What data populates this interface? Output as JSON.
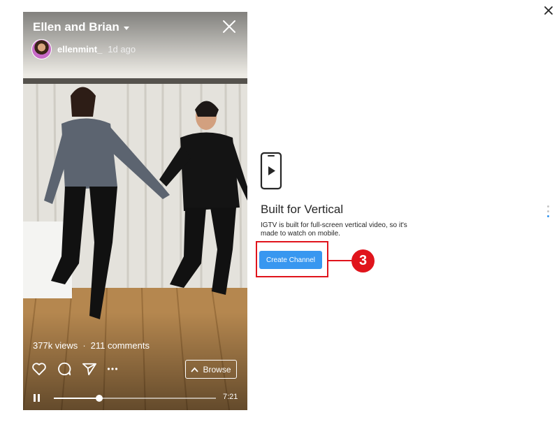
{
  "video": {
    "title": "Ellen and Brian",
    "username": "ellenmint_",
    "timestamp": "1d ago",
    "views": "377k views",
    "separator": "·",
    "comments": "211 comments",
    "browse_label": "Browse",
    "duration": "7:21",
    "progress": 0.28
  },
  "panel": {
    "title": "Built for Vertical",
    "description": "IGTV is built for full-screen vertical video, so it's made to watch on mobile.",
    "create_button": "Create Channel",
    "step_number": "3",
    "highlight_color": "#e0141c",
    "accent_color": "#3897f0"
  },
  "icons": {
    "page_close": "close-icon",
    "card_close": "close-icon",
    "like": "heart-icon",
    "comment": "comment-icon",
    "share": "send-icon",
    "more": "more-icon",
    "browse": "chevron-up-icon",
    "pause": "pause-icon",
    "phone": "phone-play-icon"
  },
  "pagination": {
    "count": 3,
    "active_index": 2
  }
}
